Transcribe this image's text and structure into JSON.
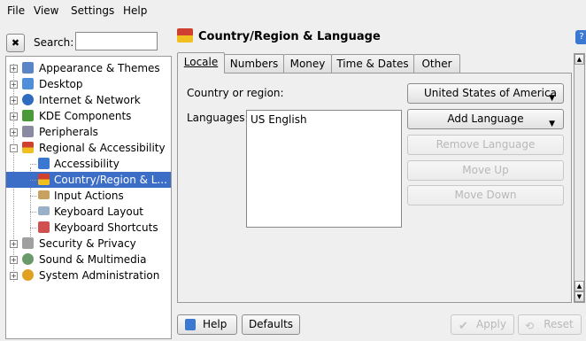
{
  "menubar": {
    "items": [
      {
        "label": "File"
      },
      {
        "label": "View"
      },
      {
        "label": "Settings"
      },
      {
        "label": "Help"
      }
    ]
  },
  "search": {
    "label": "Search:",
    "value": ""
  },
  "tree": {
    "items": [
      {
        "label": "Appearance & Themes",
        "icon": "appearance-icon",
        "color": "#5a86c8"
      },
      {
        "label": "Desktop",
        "icon": "desktop-icon",
        "color": "#4f8ed8"
      },
      {
        "label": "Internet & Network",
        "icon": "globe-icon",
        "color": "#2f6cc0"
      },
      {
        "label": "KDE Components",
        "icon": "kde-components-icon",
        "color": "#4a9a3a"
      },
      {
        "label": "Peripherals",
        "icon": "peripherals-icon",
        "color": "#8a8aa0"
      },
      {
        "label": "Regional & Accessibility",
        "icon": "flag-icon",
        "color": "#d04030"
      },
      {
        "label": "Accessibility",
        "icon": "accessibility-icon",
        "color": "#3a78d2"
      },
      {
        "label": "Country/Region & L...",
        "icon": "flag-icon",
        "color": "#d04030"
      },
      {
        "label": "Input Actions",
        "icon": "input-actions-icon",
        "color": "#c8a060"
      },
      {
        "label": "Keyboard Layout",
        "icon": "keyboard-icon",
        "color": "#9ab0c8"
      },
      {
        "label": "Keyboard Shortcuts",
        "icon": "shortcuts-icon",
        "color": "#d05050"
      },
      {
        "label": "Security & Privacy",
        "icon": "security-icon",
        "color": "#a0a0a0"
      },
      {
        "label": "Sound & Multimedia",
        "icon": "sound-icon",
        "color": "#6a9a6a"
      },
      {
        "label": "System Administration",
        "icon": "system-admin-icon",
        "color": "#e0a020"
      }
    ]
  },
  "module": {
    "title": "Country/Region & Language"
  },
  "tabs": [
    {
      "label": "Locale"
    },
    {
      "label": "Numbers"
    },
    {
      "label": "Money"
    },
    {
      "label": "Time & Dates"
    },
    {
      "label": "Other"
    }
  ],
  "locale": {
    "country_label": "Country or region:",
    "country_value": "United States of America",
    "languages_label": "Languages:",
    "languages": [
      "US English"
    ],
    "add_language": "Add Language",
    "remove_language": "Remove Language",
    "move_up": "Move Up",
    "move_down": "Move Down"
  },
  "footer": {
    "help": "Help",
    "defaults": "Defaults",
    "apply": "Apply",
    "reset": "Reset"
  }
}
